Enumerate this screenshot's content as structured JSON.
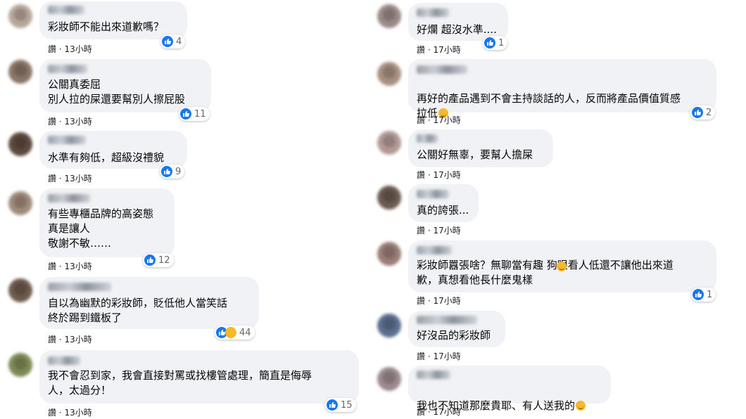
{
  "left": [
    {
      "lines": "彩妝師不能出來道歉嗎？",
      "meta_action": "讚",
      "meta_time": "13小時",
      "count": "4",
      "avatar": "#b7a79b"
    },
    {
      "lines": "公關真委屈\n別人拉的屎還要幫別人擦屁股",
      "meta_action": "讚",
      "meta_time": "13小時",
      "count": "11",
      "avatar": "#8a7566"
    },
    {
      "lines": "水準有夠低，超級沒禮貌",
      "meta_action": "讚",
      "meta_time": "13小時",
      "count": "9",
      "avatar": "#5c4a3e"
    },
    {
      "lines": "有些專櫃品牌的高姿態\n真是讓人\n敬謝不敏……",
      "meta_action": "讚",
      "meta_time": "13小時",
      "count": "12",
      "avatar": "#a08a7a"
    },
    {
      "lines": "自以為幽默的彩妝師，貶低他人當笑話\n終於踢到鐵板了",
      "meta_action": "讚",
      "meta_time": "13小時",
      "count": "44",
      "avatar": "#6e5a4c"
    },
    {
      "lines": "我不會忍到家，我會直接對罵或找樓管處理，簡直是侮辱\n人，太過分！",
      "meta_action": "讚",
      "meta_time": "13小時",
      "count": "15",
      "avatar": "#7d8a55"
    }
  ],
  "right": [
    {
      "lines": "好爛 超沒水準....",
      "meta_action": "讚",
      "meta_time": "17小時",
      "count": "1",
      "avatar": "#9c8a88"
    },
    {
      "lines": "再好的產品遇到不會主持談話的人，反而將產品價值質感\n拉低",
      "meta_action": "讚",
      "meta_time": "17小時",
      "count": "2",
      "avatar": "#a89080"
    },
    {
      "lines": "公關好無辜，要幫人擔屎",
      "meta_action": "讚",
      "meta_time": "17小時",
      "count": "",
      "avatar": "#b39a98"
    },
    {
      "lines": "真的誇張...",
      "meta_action": "讚",
      "meta_time": "17小時",
      "count": "",
      "avatar": "#6b5a50"
    },
    {
      "lines": "彩妝師囂張啥？無聊當有趣  狗眼看人低還不讓他出來道\n歉，真想看他長什麼鬼樣",
      "meta_action": "讚",
      "meta_time": "17小時",
      "count": "1",
      "avatar": "#9a7e78"
    },
    {
      "lines": "好沒品的彩妝師",
      "meta_action": "讚",
      "meta_time": "17小時",
      "count": "",
      "avatar": "#5a6f8e"
    },
    {
      "lines": "我也不知道那麼貴耶、有人送我的",
      "meta_action": "讚",
      "meta_time": "17小時",
      "count": "",
      "avatar": "#9b8a8e"
    }
  ]
}
